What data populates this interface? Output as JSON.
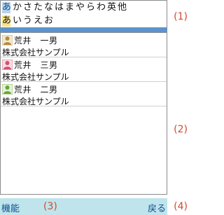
{
  "index": {
    "row1": [
      "あ",
      "か",
      "さ",
      "た",
      "な",
      "は",
      "ま",
      "や",
      "ら",
      "わ",
      "英",
      "他"
    ],
    "row2": [
      "あ",
      "い",
      "う",
      "え",
      "お"
    ]
  },
  "contacts": [
    {
      "name": "荒井　一男",
      "company": "株式会社サンプル",
      "avatar": "person-brown-icon"
    },
    {
      "name": "荒井　三男",
      "company": "株式会社サンプル",
      "avatar": "person-pink-icon"
    },
    {
      "name": "荒井　二男",
      "company": "株式会社サンプル",
      "avatar": "person-green-icon"
    }
  ],
  "markers": {
    "m1": "(1)",
    "m2": "(2)",
    "m3": "(3)",
    "m4": "(4)"
  },
  "softkeys": {
    "left": "機能",
    "right": "戻る"
  },
  "colors": {
    "accent": "#5a93cf",
    "bottom_bar": "#bfe4ec",
    "marker": "#d14a2f"
  }
}
